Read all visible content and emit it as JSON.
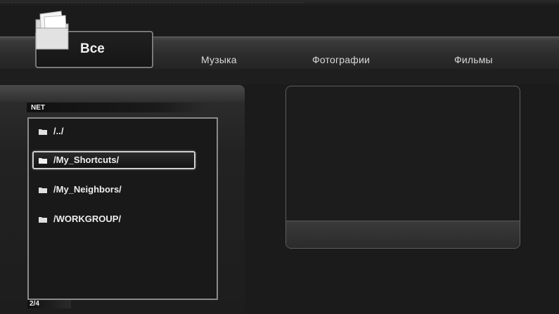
{
  "tabs": [
    {
      "label": "Все",
      "active": true
    },
    {
      "label": "Музыка",
      "active": false
    },
    {
      "label": "Фотографии",
      "active": false
    },
    {
      "label": "Фильмы",
      "active": false
    }
  ],
  "browser": {
    "location": "NET",
    "items": [
      {
        "label": "/../",
        "icon": "folder-icon"
      },
      {
        "label": "/My_Shortcuts/",
        "icon": "folder-icon",
        "selected": true
      },
      {
        "label": "/My_Neighbors/",
        "icon": "folder-icon"
      },
      {
        "label": "/WORKGROUP/",
        "icon": "folder-icon"
      }
    ],
    "page_counter": "2/4"
  },
  "colors": {
    "background": "#1b1b1b",
    "panel": "#2c2c2c",
    "text": "#ededed",
    "selection_border": "#cfcfcf"
  }
}
